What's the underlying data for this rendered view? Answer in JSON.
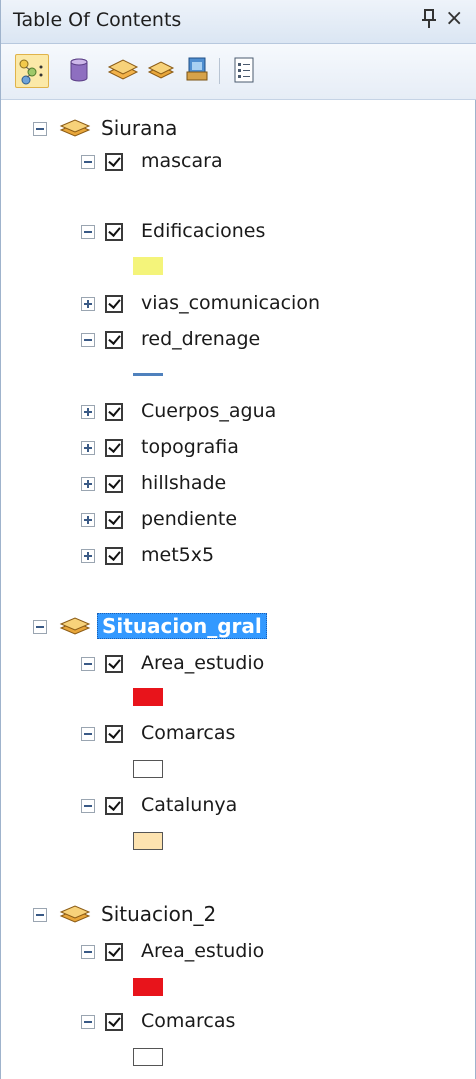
{
  "panel": {
    "title": "Table Of Contents",
    "pin_glyph": "q",
    "close_glyph": "×"
  },
  "toolbar": {
    "buttons": [
      {
        "name": "list-by-drawing-order",
        "icon": "list-by-drawing-order-icon",
        "active": true
      },
      {
        "name": "list-by-source",
        "icon": "database-icon"
      },
      {
        "name": "list-by-visibility",
        "icon": "layers-visibility-icon"
      },
      {
        "name": "list-by-selection",
        "icon": "selection-icon"
      },
      {
        "name": "options",
        "icon": "options-list-icon"
      }
    ]
  },
  "groups": [
    {
      "name": "Siurana",
      "layers": [
        {
          "name": "mascara",
          "expanded": true,
          "symbol": null
        },
        {
          "name": "Edificaciones",
          "expanded": true,
          "symbol": {
            "type": "fill",
            "color": "#f4f47a",
            "outline": "#f4f47a"
          }
        },
        {
          "name": "vias_comunicacion",
          "expanded": false
        },
        {
          "name": "red_drenage",
          "expanded": true,
          "symbol": {
            "type": "line",
            "color": "#4f81bd"
          }
        },
        {
          "name": "Cuerpos_agua",
          "expanded": false
        },
        {
          "name": "topografia",
          "expanded": false
        },
        {
          "name": "hillshade",
          "expanded": false
        },
        {
          "name": "pendiente",
          "expanded": false
        },
        {
          "name": "met5x5",
          "expanded": false
        }
      ]
    },
    {
      "name": "Situacion_gral",
      "selected": true,
      "layers": [
        {
          "name": "Area_estudio",
          "expanded": true,
          "symbol": {
            "type": "fill",
            "color": "#e8141b",
            "outline": "#e8141b"
          }
        },
        {
          "name": "Comarcas",
          "expanded": true,
          "symbol": {
            "type": "fill",
            "color": "#ffffff",
            "outline": "#555555"
          }
        },
        {
          "name": "Catalunya",
          "expanded": true,
          "symbol": {
            "type": "fill",
            "color": "#fde3b0",
            "outline": "#555555"
          }
        }
      ]
    },
    {
      "name": "Situacion_2",
      "layers": [
        {
          "name": "Area_estudio",
          "expanded": true,
          "symbol": {
            "type": "fill",
            "color": "#e8141b",
            "outline": "#e8141b"
          }
        },
        {
          "name": "Comarcas",
          "expanded": true,
          "symbol": {
            "type": "fill",
            "color": "#ffffff",
            "outline": "#555555"
          }
        }
      ]
    }
  ]
}
